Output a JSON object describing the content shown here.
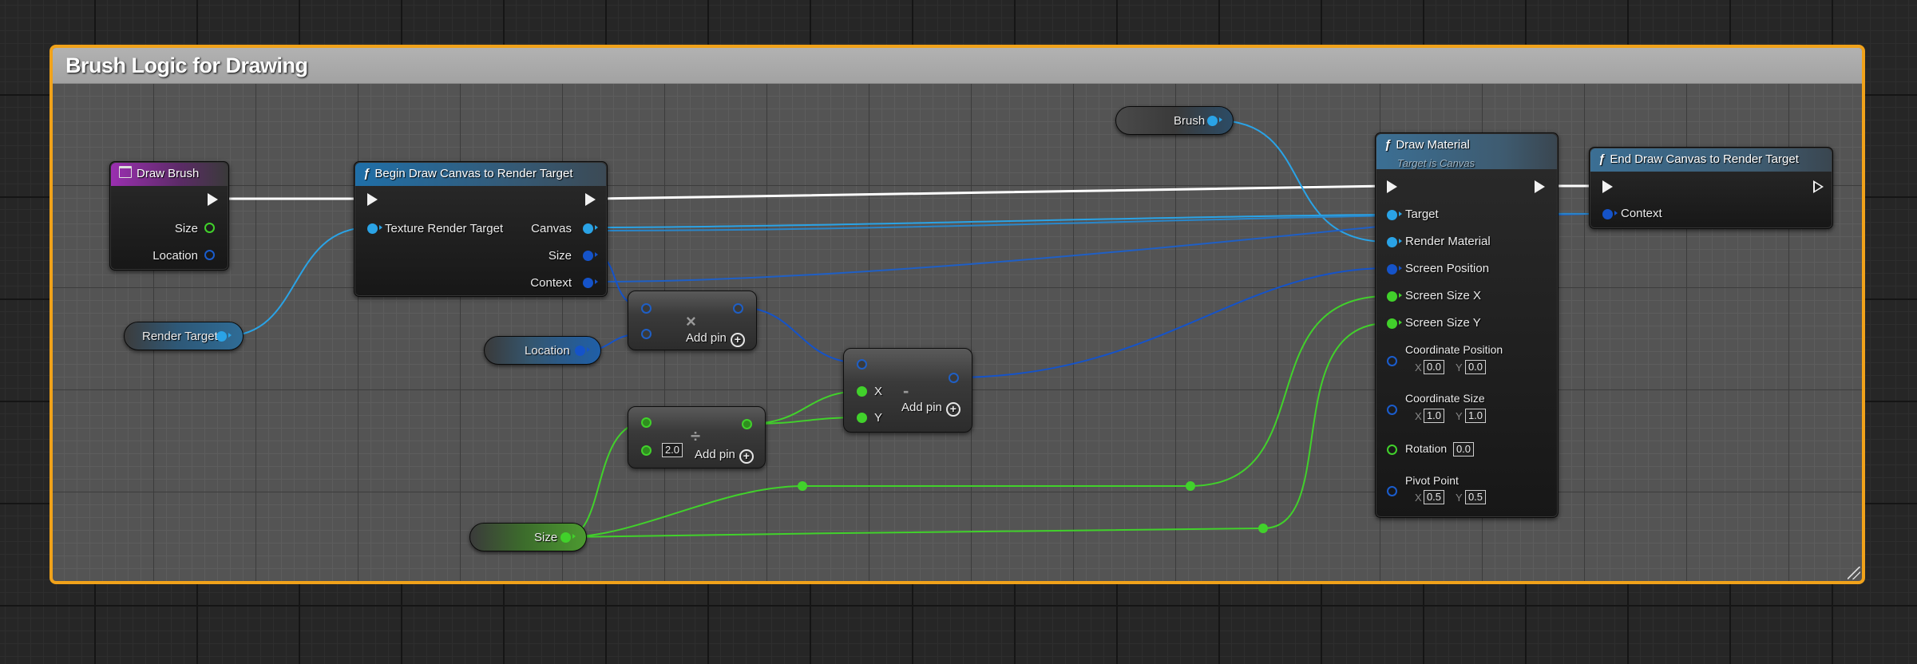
{
  "comment": {
    "title": "Brush Logic for Drawing"
  },
  "colors": {
    "comment_border": "#f0a21a",
    "wire_exec": "#ffffff",
    "wire_object": "#2aa3e6",
    "wire_struct": "#1553c9",
    "wire_float": "#41d12b"
  },
  "draw_brush": {
    "title": "Draw Brush",
    "pins": {
      "size": "Size",
      "location": "Location"
    }
  },
  "begin_draw": {
    "title": "Begin Draw Canvas to Render Target",
    "pins": {
      "texture_render_target": "Texture Render Target",
      "canvas": "Canvas",
      "size": "Size",
      "context": "Context"
    }
  },
  "render_target_var": {
    "label": "Render Target"
  },
  "location_var": {
    "label": "Location"
  },
  "size_var": {
    "label": "Size"
  },
  "brush_var": {
    "label": "Brush"
  },
  "multiply_node": {
    "operator": "×",
    "add_pin": "Add pin"
  },
  "divide_node": {
    "operator": "÷",
    "value": "2.0",
    "add_pin": "Add pin"
  },
  "subtract_node": {
    "operator": "-",
    "pin_x": "X",
    "pin_y": "Y",
    "add_pin": "Add pin"
  },
  "draw_material": {
    "title": "Draw Material",
    "subtitle": "Target is Canvas",
    "pins": {
      "target": "Target",
      "render_material": "Render Material",
      "screen_position": "Screen Position",
      "screen_size_x": "Screen Size X",
      "screen_size_y": "Screen Size Y",
      "coordinate_position": "Coordinate Position",
      "coordinate_size": "Coordinate Size",
      "rotation": "Rotation",
      "pivot_point": "Pivot Point"
    },
    "values": {
      "coord_pos_x": "0.0",
      "coord_pos_y": "0.0",
      "coord_size_x": "1.0",
      "coord_size_y": "1.0",
      "rotation": "0.0",
      "pivot_x": "0.5",
      "pivot_y": "0.5"
    },
    "axis": {
      "x": "X",
      "y": "Y"
    }
  },
  "end_draw": {
    "title": "End Draw Canvas to Render Target",
    "pins": {
      "context": "Context"
    }
  },
  "icons": {
    "function": "function-icon",
    "event": "event-icon",
    "exec": "exec-pin-icon",
    "add": "add-pin-icon"
  }
}
